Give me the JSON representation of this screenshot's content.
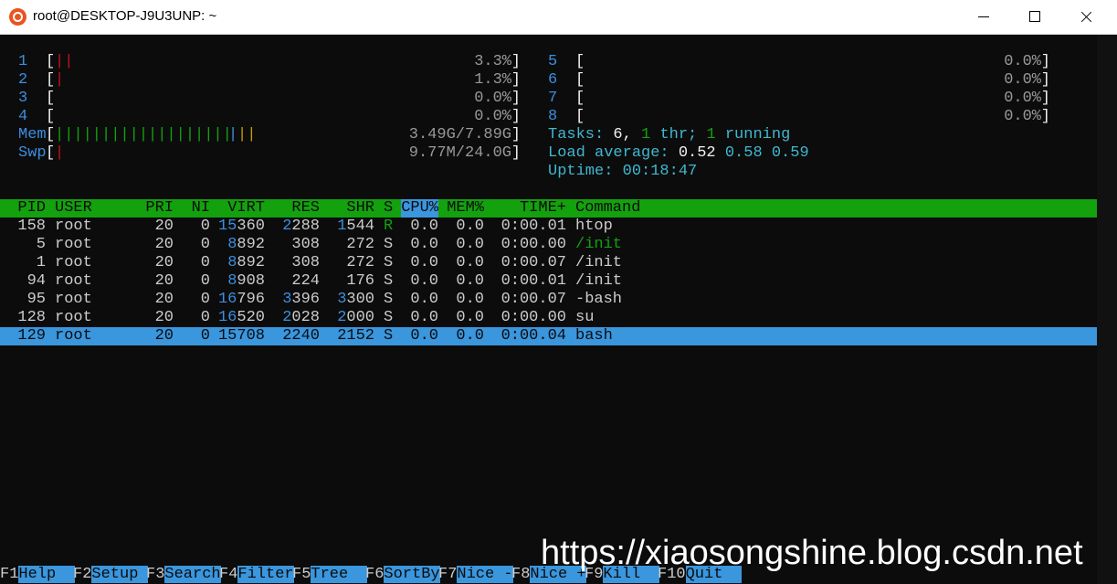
{
  "window": {
    "title": "root@DESKTOP-J9U3UNP: ~"
  },
  "meters": {
    "cpus_left": [
      {
        "id": "1",
        "value": "3.3%",
        "fill": 0.033
      },
      {
        "id": "2",
        "value": "1.3%",
        "fill": 0.013
      },
      {
        "id": "3",
        "value": "0.0%",
        "fill": 0
      },
      {
        "id": "4",
        "value": "0.0%",
        "fill": 0
      }
    ],
    "cpus_right": [
      {
        "id": "5",
        "value": "0.0%",
        "fill": 0
      },
      {
        "id": "6",
        "value": "0.0%",
        "fill": 0
      },
      {
        "id": "7",
        "value": "0.0%",
        "fill": 0
      },
      {
        "id": "8",
        "value": "0.0%",
        "fill": 0
      }
    ],
    "mem": {
      "label": "Mem",
      "value": "3.49G/7.89G",
      "fill": 0.442
    },
    "swp": {
      "label": "Swp",
      "value": "9.77M/24.0G",
      "fill": 0.0004
    }
  },
  "summary": {
    "tasks_label": "Tasks:",
    "tasks": "6,",
    "thr": "1",
    "thr_label": "thr;",
    "running": "1",
    "running_label": "running",
    "load_label": "Load average:",
    "load1": "0.52",
    "load5": "0.58",
    "load15": "0.59",
    "uptime_label": "Uptime:",
    "uptime": "00:18:47"
  },
  "columns": [
    "PID",
    "USER",
    "PRI",
    "NI",
    "VIRT",
    "RES",
    "SHR",
    "S",
    "CPU%",
    "MEM%",
    "TIME+",
    "Command"
  ],
  "sort_column": "CPU%",
  "processes": [
    {
      "pid": "158",
      "user": "root",
      "pri": "20",
      "ni": "0",
      "virt": "15360",
      "res": "2288",
      "shr": "1544",
      "s": "R",
      "cpu": "0.0",
      "mem": "0.0",
      "time": "0:00.01",
      "cmd": "htop"
    },
    {
      "pid": "5",
      "user": "root",
      "pri": "20",
      "ni": "0",
      "virt": "8892",
      "res": "308",
      "shr": "272",
      "s": "S",
      "cpu": "0.0",
      "mem": "0.0",
      "time": "0:00.00",
      "cmd": "/init"
    },
    {
      "pid": "1",
      "user": "root",
      "pri": "20",
      "ni": "0",
      "virt": "8892",
      "res": "308",
      "shr": "272",
      "s": "S",
      "cpu": "0.0",
      "mem": "0.0",
      "time": "0:00.07",
      "cmd": "/init"
    },
    {
      "pid": "94",
      "user": "root",
      "pri": "20",
      "ni": "0",
      "virt": "8908",
      "res": "224",
      "shr": "176",
      "s": "S",
      "cpu": "0.0",
      "mem": "0.0",
      "time": "0:00.01",
      "cmd": "/init"
    },
    {
      "pid": "95",
      "user": "root",
      "pri": "20",
      "ni": "0",
      "virt": "16796",
      "res": "3396",
      "shr": "3300",
      "s": "S",
      "cpu": "0.0",
      "mem": "0.0",
      "time": "0:00.07",
      "cmd": "-bash"
    },
    {
      "pid": "128",
      "user": "root",
      "pri": "20",
      "ni": "0",
      "virt": "16520",
      "res": "2028",
      "shr": "2000",
      "s": "S",
      "cpu": "0.0",
      "mem": "0.0",
      "time": "0:00.00",
      "cmd": "su"
    },
    {
      "pid": "129",
      "user": "root",
      "pri": "20",
      "ni": "0",
      "virt": "15708",
      "res": "2240",
      "shr": "2152",
      "s": "S",
      "cpu": "0.0",
      "mem": "0.0",
      "time": "0:00.04",
      "cmd": "bash"
    }
  ],
  "selected_pid": "129",
  "function_keys": [
    {
      "key": "F1",
      "label": "Help"
    },
    {
      "key": "F2",
      "label": "Setup"
    },
    {
      "key": "F3",
      "label": "Search"
    },
    {
      "key": "F4",
      "label": "Filter"
    },
    {
      "key": "F5",
      "label": "Tree"
    },
    {
      "key": "F6",
      "label": "SortBy"
    },
    {
      "key": "F7",
      "label": "Nice -"
    },
    {
      "key": "F8",
      "label": "Nice +"
    },
    {
      "key": "F9",
      "label": "Kill"
    },
    {
      "key": "F10",
      "label": "Quit"
    }
  ],
  "watermark": "https://xiaosongshine.blog.csdn.net"
}
